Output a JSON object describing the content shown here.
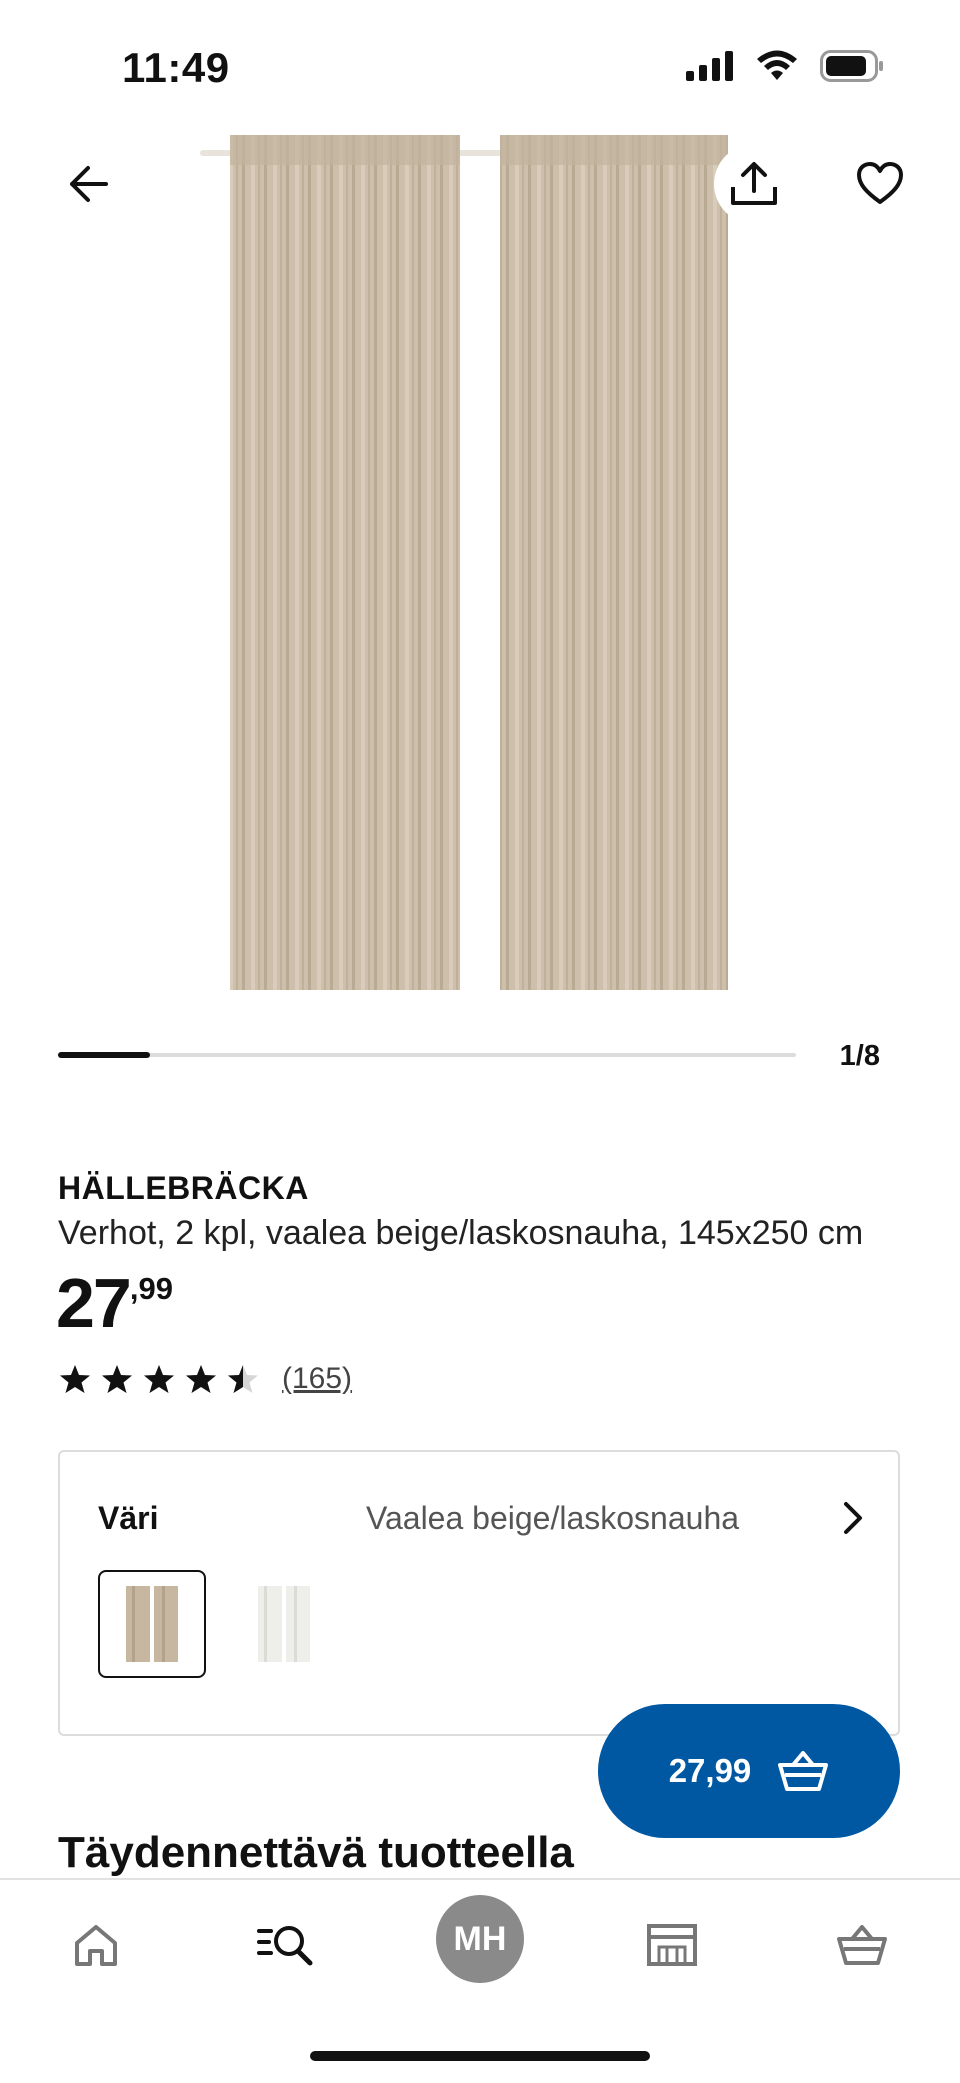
{
  "status_bar": {
    "time": "11:49"
  },
  "gallery": {
    "counter": "1/8",
    "progress": 0.125
  },
  "product": {
    "name": "HÄLLEBRÄCKA",
    "description": "Verhot, 2 kpl, vaalea beige/laskosnauha, 145x250 cm",
    "price_int": "27",
    "price_dec": ",99",
    "rating": 4.5,
    "review_count": "(165)"
  },
  "color": {
    "label": "Väri",
    "value": "Vaalea beige/laskosnauha"
  },
  "buy_button": {
    "price": "27,99"
  },
  "section": {
    "title": "Täydennettävä tuotteella"
  },
  "nav": {
    "avatar_initials": "MH"
  },
  "colors": {
    "accent": "#0058a3",
    "curtain": "#cdbfab",
    "avatar": "#8a8a8a"
  }
}
